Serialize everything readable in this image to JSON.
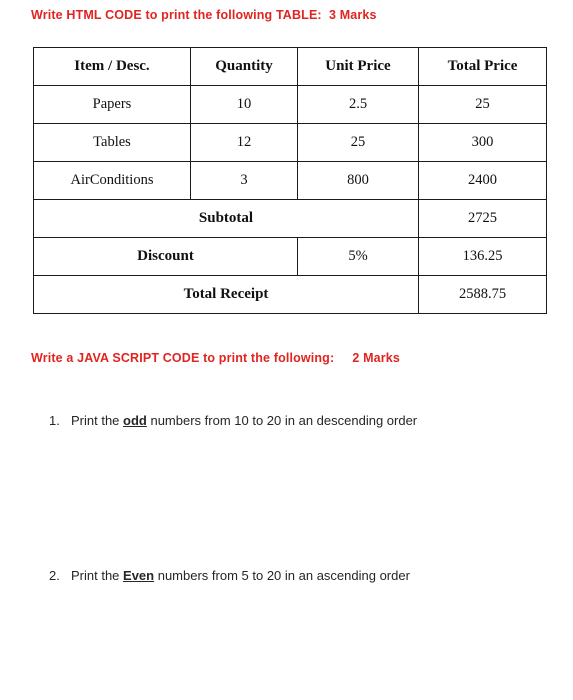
{
  "page": {
    "background": "#ffffff",
    "accent_red": "#e02420",
    "text_color": "#262626",
    "table_border_color": "#1b1b1b"
  },
  "questions": [
    {
      "id": "q-html-table",
      "heading": "Write HTML CODE to print the following TABLE:  3 Marks"
    },
    {
      "id": "q-javascript",
      "heading": "Write a JAVA SCRIPT CODE to print the following:     2 Marks"
    }
  ],
  "receipt_table": {
    "headers": [
      "Item / Desc.",
      "Quantity",
      "Unit Price",
      "Total Price"
    ],
    "rows": [
      {
        "item": "Papers",
        "quantity": "10",
        "unit_price": "2.5",
        "total_price": "25"
      },
      {
        "item": "Tables",
        "quantity": "12",
        "unit_price": "25",
        "total_price": "300"
      },
      {
        "item": "AirConditions",
        "quantity": "3",
        "unit_price": "800",
        "total_price": "2400"
      }
    ],
    "summary": {
      "subtotal_label": "Subtotal",
      "subtotal_value": "2725",
      "discount_label": "Discount",
      "discount_rate": "5%",
      "discount_value": "136.25",
      "total_label": "Total Receipt",
      "total_value": "2588.75"
    }
  },
  "tasks": [
    {
      "number": "1.",
      "prefix": "Print the ",
      "emphasis": "odd",
      "suffix": " numbers from 10 to 20 in an descending order"
    },
    {
      "number": "2.",
      "prefix": "Print the ",
      "emphasis": "Even",
      "suffix": " numbers from 5 to 20 in an ascending order"
    }
  ]
}
